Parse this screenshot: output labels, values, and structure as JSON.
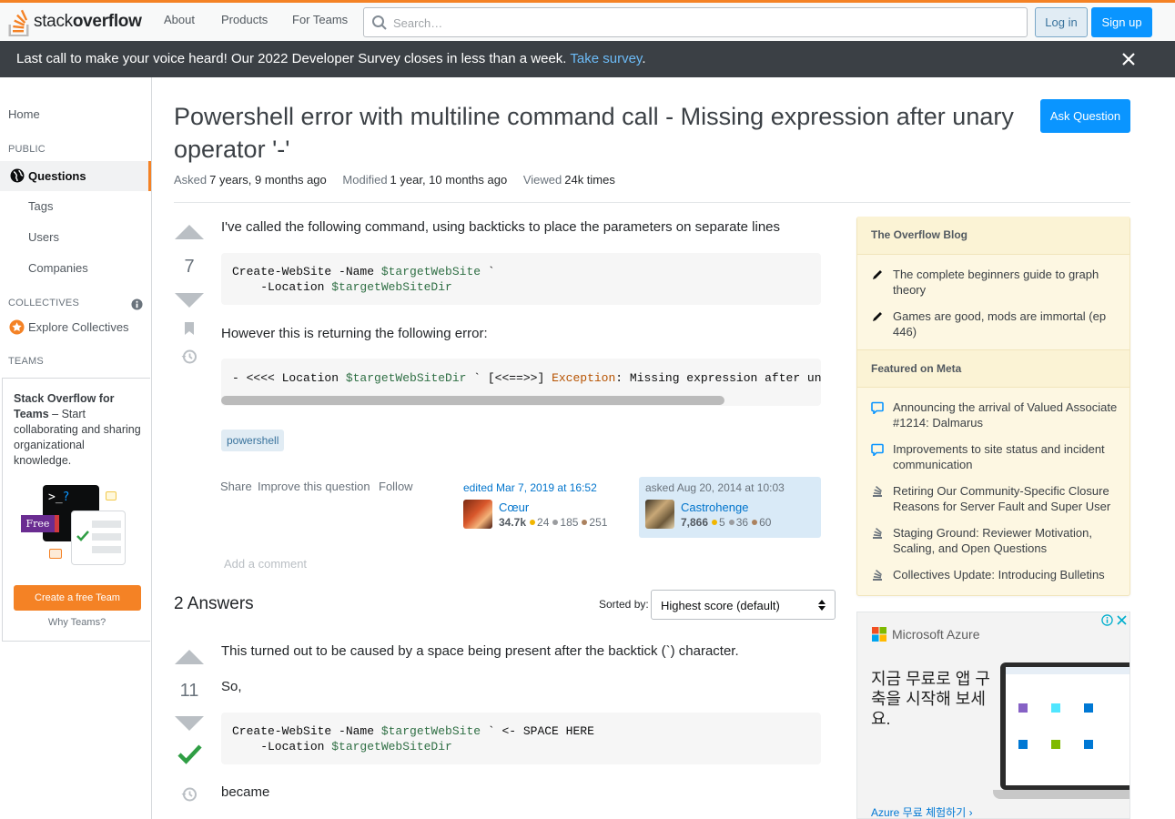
{
  "header": {
    "logo_text_regular": "stack",
    "logo_text_bold": "overflow",
    "nav": [
      "About",
      "Products",
      "For Teams"
    ],
    "search_placeholder": "Search…",
    "login_label": "Log in",
    "signup_label": "Sign up"
  },
  "banner": {
    "text": "Last call to make your voice heard! Our 2022 Developer Survey closes in less than a week.",
    "link": "Take survey",
    "after_link": "."
  },
  "sidebar": {
    "home": "Home",
    "public_label": "PUBLIC",
    "questions": "Questions",
    "tags": "Tags",
    "users": "Users",
    "companies": "Companies",
    "collectives_label": "COLLECTIVES",
    "explore_collectives": "Explore Collectives",
    "teams_label": "TEAMS",
    "teams_promo_bold": "Stack Overflow for Teams",
    "teams_promo_text": " – Start collaborating and sharing organizational knowledge.",
    "free_badge": "Free",
    "create_team": "Create a free Team",
    "why_teams": "Why Teams?"
  },
  "question": {
    "title": "Powershell error with multiline command call - Missing expression after unary operator '-'",
    "ask_button": "Ask Question",
    "asked_label": "Asked",
    "asked_value": "7 years, 9 months ago",
    "modified_label": "Modified",
    "modified_value": "1 year, 10 months ago",
    "viewed_label": "Viewed",
    "viewed_value": "24k times",
    "score": "7",
    "body_p1": "I've called the following command, using backticks to place the parameters on separate lines",
    "code1": {
      "l1_a": "Create-WebSite -Name ",
      "l1_var": "$targetWebSite",
      "l1_b": " `",
      "l2_a": "    -Location ",
      "l2_var": "$targetWebSiteDir"
    },
    "body_p2": "However this is returning the following error:",
    "code2": {
      "a": "- <<<< Location ",
      "var": "$targetWebSiteDir",
      "b": " ` [<<==>>] ",
      "exc": "Exception",
      "c": ": Missing expression after unar"
    },
    "tag": "powershell",
    "links": [
      "Share",
      "Improve this question",
      "Follow"
    ],
    "edited": {
      "when": "edited Mar 7, 2019 at 16:52",
      "user": "Cœur",
      "rep": "34.7k",
      "gold": "24",
      "silver": "185",
      "bronze": "251"
    },
    "asked_card": {
      "when": "asked Aug 20, 2014 at 10:03",
      "user": "Castrohenge",
      "rep": "7,866",
      "gold": "5",
      "silver": "36",
      "bronze": "60"
    },
    "add_comment": "Add a comment"
  },
  "answers": {
    "heading": "2 Answers",
    "sorted_label": "Sorted by:",
    "sort_value": "Highest score (default)",
    "first": {
      "score": "11",
      "p1": "This turned out to be caused by a space being present after the backtick (`) character.",
      "p2": "So,",
      "code": {
        "l1_a": "Create-WebSite -Name ",
        "l1_var": "$targetWebSite",
        "l1_b": " ` <- SPACE HERE",
        "l2_a": "    -Location ",
        "l2_var": "$targetWebSiteDir"
      },
      "p3": "became"
    }
  },
  "blog": {
    "heading1": "The Overflow Blog",
    "items1": [
      "The complete beginners guide to graph theory",
      "Games are good, mods are immortal (ep 446)"
    ],
    "heading2": "Featured on Meta",
    "items2": [
      "Announcing the arrival of Valued Associate #1214: Dalmarus",
      "Improvements to site status and incident communication",
      "Retiring Our Community-Specific Closure Reasons for Server Fault and Super User",
      "Staging Ground: Reviewer Motivation, Scaling, and Open Questions",
      "Collectives Update: Introducing Bulletins"
    ]
  },
  "ad": {
    "brand": "Microsoft Azure",
    "text": "지금 무료로 앱 구축을 시작해 보세요.",
    "link": "Azure 무료 체험하기 ›"
  },
  "colors": {
    "accent_orange": "#f48225",
    "primary_blue": "#0a95ff",
    "banner_bg": "#3b4045",
    "accepted_green": "#2f9e44"
  }
}
